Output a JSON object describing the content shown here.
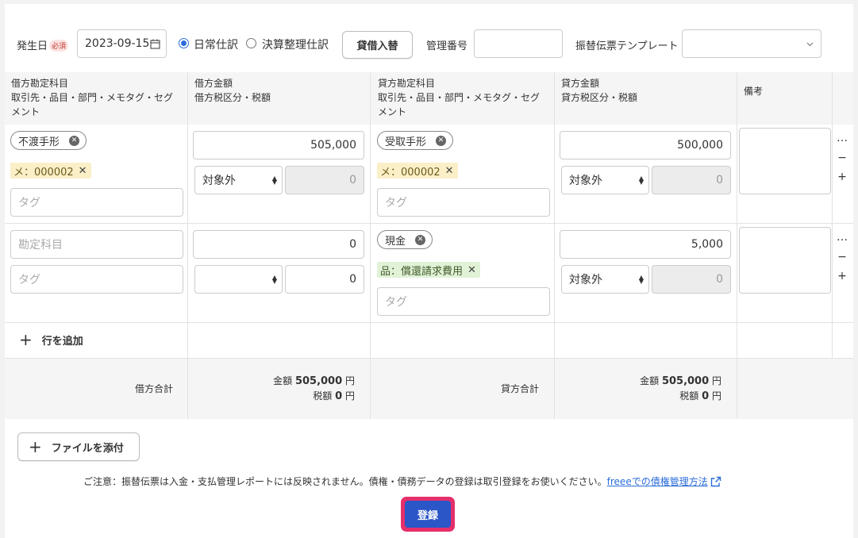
{
  "header": {
    "date_label": "発生日",
    "required_badge": "必須",
    "date_value": "2023-09-15",
    "radio_normal": "日常仕訳",
    "radio_closing": "決算整理仕訳",
    "swap_button": "貸借入替",
    "mgmt_label": "管理番号",
    "mgmt_value": "",
    "template_label": "振替伝票テンプレート",
    "template_value": ""
  },
  "columns": {
    "debit_account": "借方勘定科目",
    "debit_account_sub": "取引先・品目・部門・メモタグ・セグメント",
    "debit_amount": "借方金額",
    "debit_amount_sub": "借方税区分・税額",
    "credit_account": "貸方勘定科目",
    "credit_account_sub": "取引先・品目・部門・メモタグ・セグメント",
    "credit_amount": "貸方金額",
    "credit_amount_sub": "貸方税区分・税額",
    "remarks": "備考"
  },
  "rows": [
    {
      "debit_account": "不渡手形",
      "debit_tag": "メ：000002",
      "debit_tag_placeholder": "タグ",
      "debit_amount": "505,000",
      "debit_tax_type": "対象外",
      "debit_tax": "0",
      "credit_account": "受取手形",
      "credit_tag": "メ：000002",
      "credit_tag_placeholder": "タグ",
      "credit_amount": "500,000",
      "credit_tax_type": "対象外",
      "credit_tax": "0"
    },
    {
      "debit_account_placeholder": "勘定科目",
      "debit_tag_placeholder": "タグ",
      "debit_amount": "0",
      "debit_tax_type": "",
      "debit_tax": "0",
      "credit_account": "現金",
      "credit_tag": "品：償還請求費用",
      "credit_tag_placeholder": "タグ",
      "credit_amount": "5,000",
      "credit_tax_type": "対象外",
      "credit_tax": "0"
    }
  ],
  "row_controls": {
    "more": "…",
    "minus": "−",
    "plus": "+"
  },
  "add_row": {
    "icon": "+",
    "label": "行を追加"
  },
  "totals": {
    "debit_label": "借方合計",
    "credit_label": "貸方合計",
    "amount_prefix": "金額",
    "tax_prefix": "税額",
    "yen": "円",
    "debit_amount": "505,000",
    "debit_tax": "0",
    "credit_amount": "505,000",
    "credit_tax": "0"
  },
  "attach": {
    "icon": "+",
    "label": "ファイルを添付"
  },
  "notice": {
    "text": "ご注意：振替伝票は入金・支払管理レポートには反映されません。債権・債務データの登録は取引登録をお使いください。",
    "link": "freeeでの債権管理方法"
  },
  "submit_label": "登録",
  "colors": {
    "accent": "#2b56c8",
    "highlight": "#e62f6a"
  }
}
